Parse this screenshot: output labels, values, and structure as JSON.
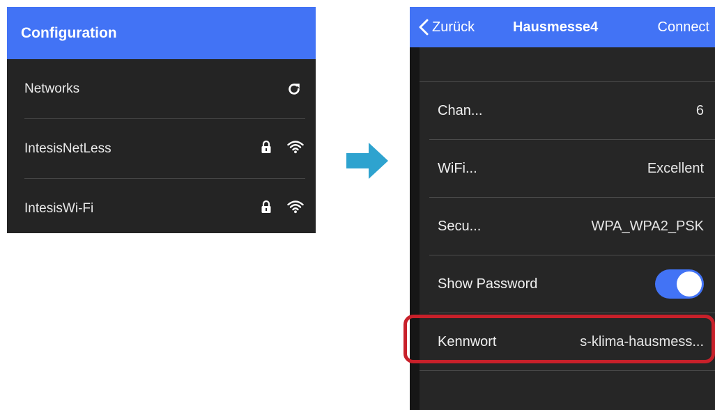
{
  "left": {
    "header_title": "Configuration",
    "rows": [
      {
        "label": "Networks",
        "icon": "refresh-icon"
      },
      {
        "label": "IntesisNetLess",
        "icons": [
          "lock-icon",
          "wifi-icon"
        ]
      },
      {
        "label": "IntesisWi-Fi",
        "icons": [
          "lock-icon",
          "wifi-icon"
        ]
      }
    ]
  },
  "right": {
    "nav": {
      "back_label": "Zurück",
      "title": "Hausmesse4",
      "connect_label": "Connect"
    },
    "rows": [
      {
        "label": "Chan...",
        "value": "6"
      },
      {
        "label": "WiFi...",
        "value": "Excellent"
      },
      {
        "label": "Secu...",
        "value": "WPA_WPA2_PSK"
      },
      {
        "label": "Show Password",
        "toggle_on": true
      },
      {
        "label": "Kennwort",
        "value": "s-klima-hausmess..."
      }
    ]
  },
  "colors": {
    "accent": "#4273f5",
    "panel_bg": "#242424",
    "arrow": "#2ea3cf",
    "highlight": "#c8202a"
  }
}
